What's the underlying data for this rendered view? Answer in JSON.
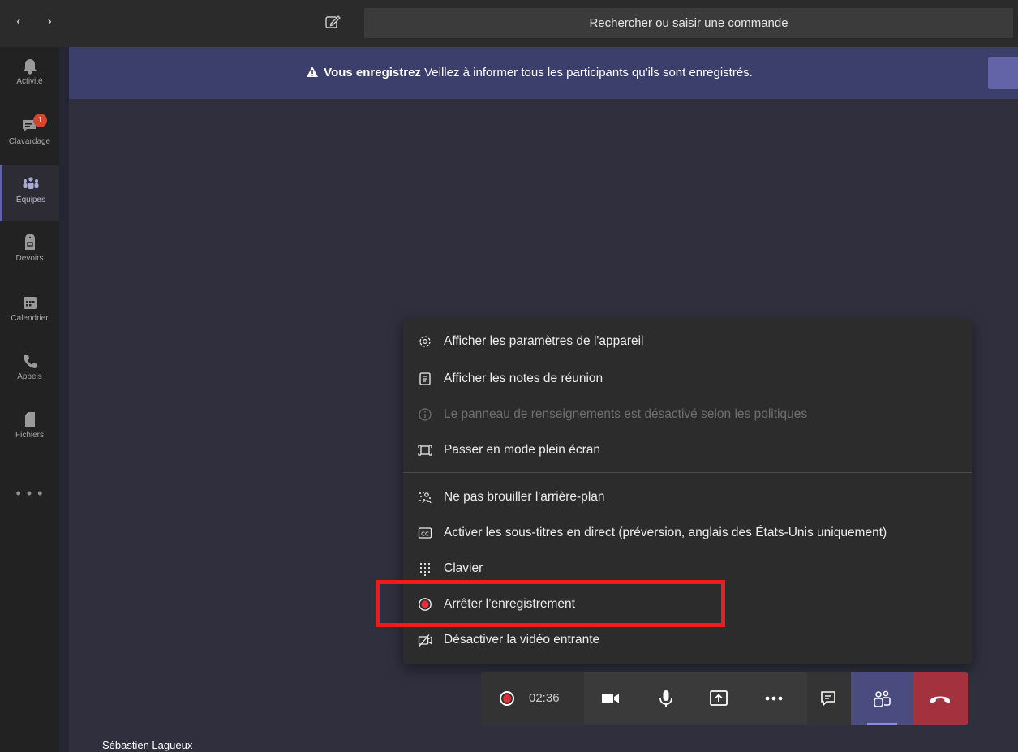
{
  "titlebar": {
    "search_placeholder": "Rechercher ou saisir une commande",
    "back_icon": "chevron-left-icon",
    "forward_icon": "chevron-right-icon",
    "compose_icon": "compose-icon"
  },
  "rail": {
    "items": [
      {
        "label": "Activité",
        "icon": "bell-icon"
      },
      {
        "label": "Clavardage",
        "icon": "chat-icon",
        "badge": "1"
      },
      {
        "label": "Équipes",
        "icon": "teams-icon",
        "active": true
      },
      {
        "label": "Devoirs",
        "icon": "assignments-icon"
      },
      {
        "label": "Calendrier",
        "icon": "calendar-icon"
      },
      {
        "label": "Appels",
        "icon": "phone-icon"
      },
      {
        "label": "Fichiers",
        "icon": "files-icon"
      }
    ],
    "more": "• • •"
  },
  "banner": {
    "bold": "Vous enregistrez",
    "text": " Veillez à informer tous les participants qu'ils sont enregistrés.",
    "icon": "warning-icon"
  },
  "menu": {
    "items": [
      {
        "label": "Afficher les paramètres de l'appareil",
        "icon": "gear-icon"
      },
      {
        "label": "Afficher les notes de réunion",
        "icon": "notes-icon"
      },
      {
        "label": "Le panneau de renseignements est désactivé selon les politiques",
        "icon": "info-icon",
        "disabled": true
      },
      {
        "label": "Passer en mode plein écran",
        "icon": "fullscreen-icon"
      },
      {
        "label": "Ne pas brouiller l'arrière-plan",
        "icon": "blur-icon"
      },
      {
        "label": "Activer les sous-titres en direct (préversion, anglais des États-Unis uniquement)",
        "icon": "captions-icon"
      },
      {
        "label": "Clavier",
        "icon": "keypad-icon"
      },
      {
        "label": "Arrêter l’enregistrement",
        "icon": "record-icon"
      },
      {
        "label": "Désactiver la vidéo entrante",
        "icon": "video-off-icon"
      }
    ]
  },
  "callbar": {
    "timer": "02:36",
    "buttons": [
      "camera-icon",
      "microphone-icon",
      "share-screen-icon",
      "more-icon",
      "chat-icon",
      "participants-icon",
      "hang-up-icon"
    ]
  },
  "participant": {
    "name": "Sébastien Lagueux"
  },
  "colors": {
    "accent": "#6264a7",
    "stage": "#2f2f3e",
    "banner": "#3c3e6b",
    "hangup": "#a4323e",
    "highlight": "#ec1c1c"
  }
}
